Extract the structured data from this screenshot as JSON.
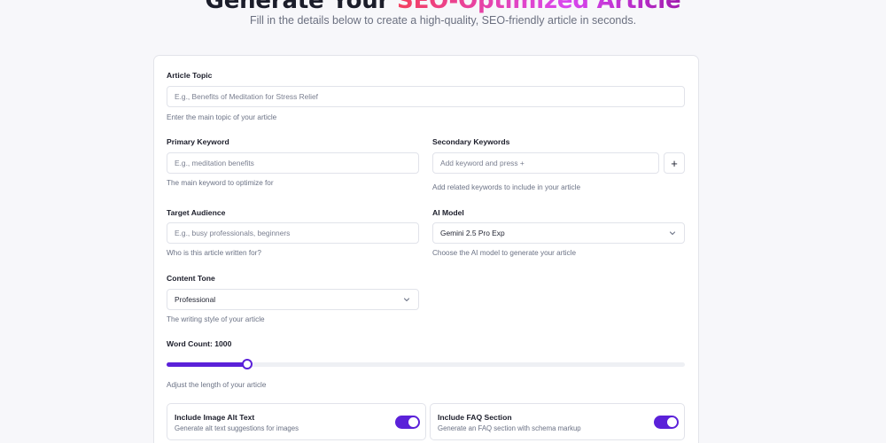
{
  "hero": {
    "title_prefix": "Generate Your",
    "title_highlight": "SEO-Optimized Article",
    "subtitle": "Fill in the details below to create a high-quality, SEO-friendly article in seconds."
  },
  "form": {
    "article_topic": {
      "label": "Article Topic",
      "placeholder": "E.g., Benefits of Meditation for Stress Relief",
      "help": "Enter the main topic of your article"
    },
    "primary_keyword": {
      "label": "Primary Keyword",
      "placeholder": "E.g., meditation benefits",
      "help": "The main keyword to optimize for"
    },
    "secondary_keywords": {
      "label": "Secondary Keywords",
      "placeholder": "Add keyword and press +",
      "add_label": "+",
      "help": "Add related keywords to include in your article"
    },
    "target_audience": {
      "label": "Target Audience",
      "placeholder": "E.g., busy professionals, beginners",
      "help": "Who is this article written for?"
    },
    "ai_model": {
      "label": "AI Model",
      "value": "Gemini 2.5 Pro Exp",
      "help": "Choose the AI model to generate your article"
    },
    "content_tone": {
      "label": "Content Tone",
      "value": "Professional",
      "help": "The writing style of your article"
    },
    "word_count": {
      "label": "Word Count: 1000",
      "value": 1000,
      "fraction": 0.155,
      "help": "Adjust the length of your article"
    },
    "options": [
      {
        "title": "Include Image Alt Text",
        "desc": "Generate alt text suggestions for images",
        "enabled": true
      },
      {
        "title": "Include FAQ Section",
        "desc": "Generate an FAQ section with schema markup",
        "enabled": true
      }
    ]
  },
  "colors": {
    "accent": "#5b21d9",
    "border": "#e1e3ea",
    "highlight_start": "#f43f5e",
    "highlight_end": "#a21caf"
  }
}
